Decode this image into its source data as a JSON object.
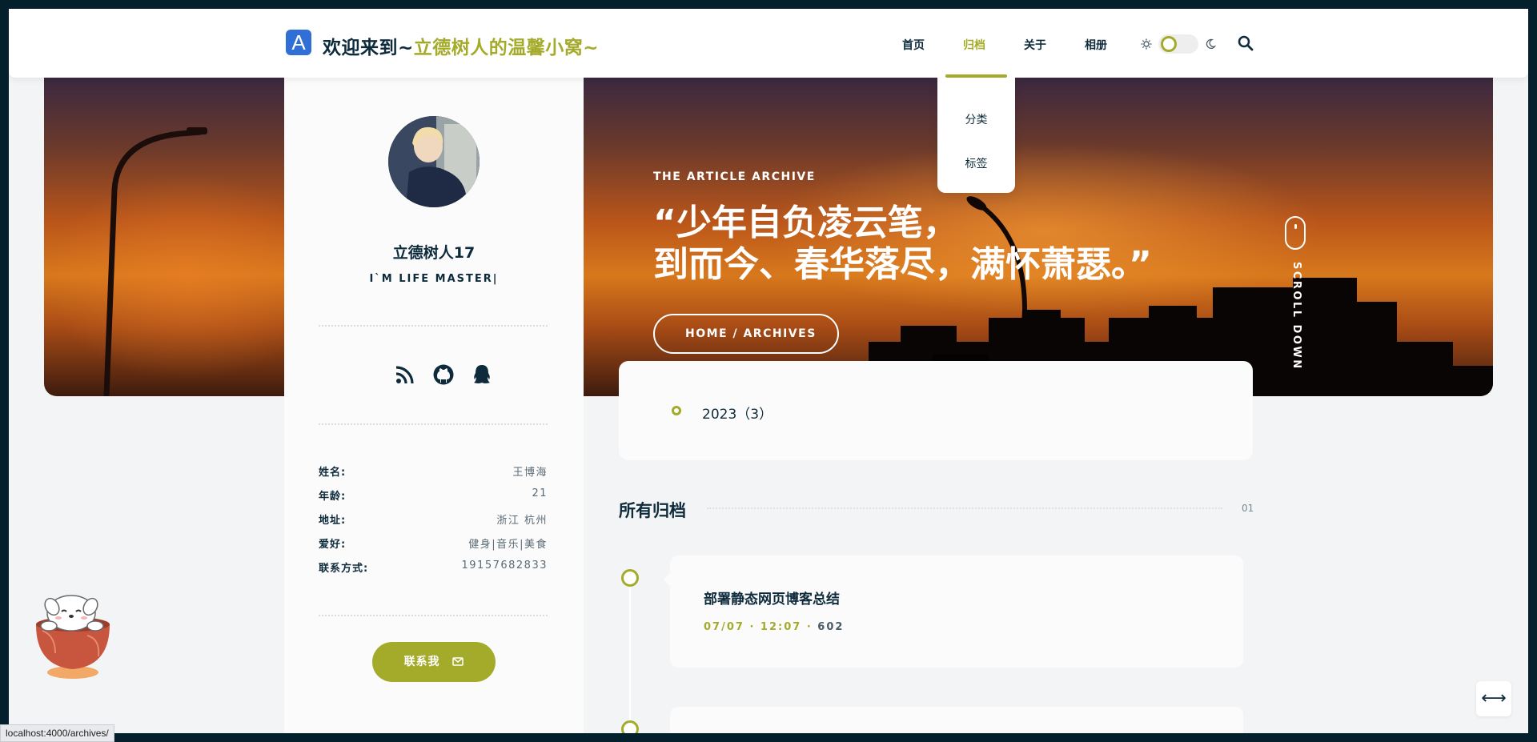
{
  "header": {
    "logo_letter": "A",
    "title_prefix": "欢迎来到~",
    "title_highlight": "立德树人的温馨小窝~",
    "nav": [
      "首页",
      "归档",
      "关于",
      "相册"
    ],
    "active_nav": "归档",
    "dropdown": [
      "分类",
      "标签"
    ]
  },
  "banner": {
    "kicker": "THE ARTICLE ARCHIVE",
    "quote_line1": "“少年自负凌云笔，",
    "quote_line2": "到而今、春华落尽，满怀萧瑟。”",
    "breadcrumb": "HOME /  ARCHIVES",
    "scroll_text": "SCROLL DOWN"
  },
  "sidebar": {
    "author": "立德树人17",
    "motto": "I`M LIFE MASTER|",
    "social_icons": [
      "rss-icon",
      "github-icon",
      "qq-icon"
    ],
    "info": [
      {
        "k": "姓名:",
        "v": "王博海"
      },
      {
        "k": "年龄:",
        "v": "21"
      },
      {
        "k": "地址:",
        "v": "浙江 杭州"
      },
      {
        "k": "爱好:",
        "v": "健身|音乐|美食"
      },
      {
        "k": "联系方式:",
        "v": "19157682833"
      }
    ],
    "contact_label": "联系我"
  },
  "archive": {
    "year_entry": "2023（3）",
    "section_title": "所有归档",
    "section_count": "01",
    "posts": [
      {
        "title": "部署静态网页博客总结",
        "date": "07/07 · 12:07 ·",
        "views": "602"
      }
    ]
  },
  "status_url": "localhost:4000/archives/",
  "colors": {
    "accent": "#a4ab2a",
    "text": "#0e2b3c",
    "bg": "#f3f4f6"
  }
}
